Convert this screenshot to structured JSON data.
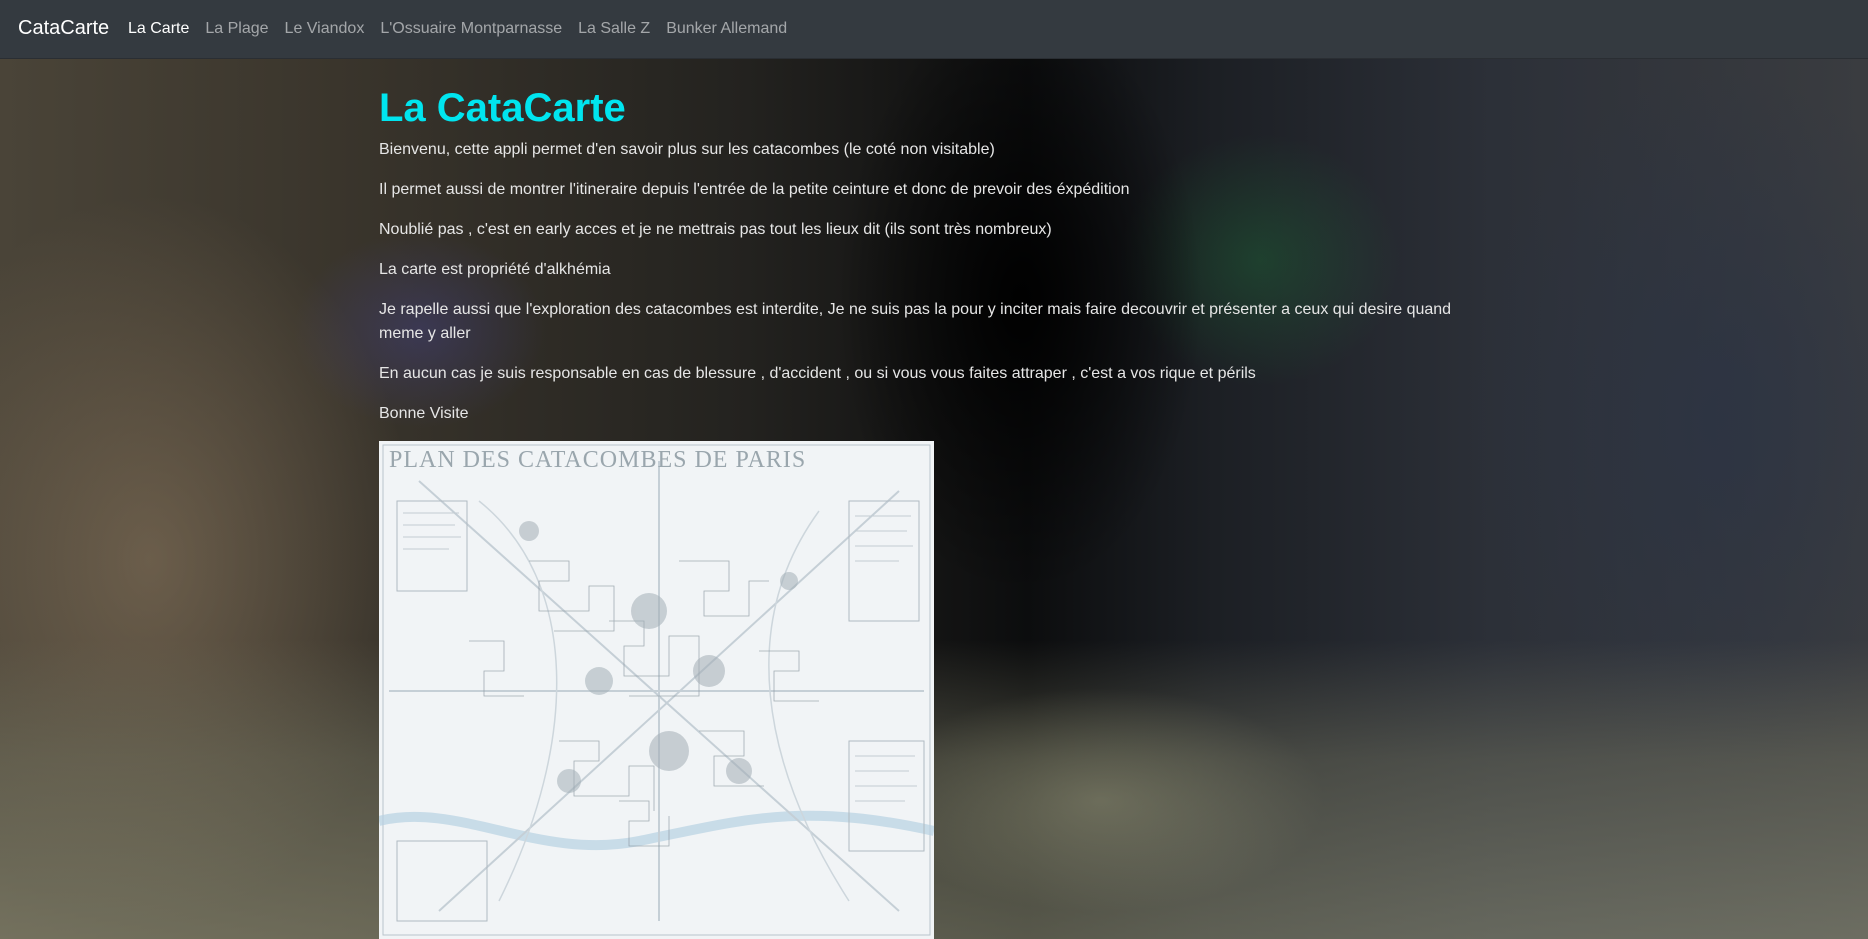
{
  "navbar": {
    "brand": "CataCarte",
    "links": [
      {
        "label": "La Carte"
      },
      {
        "label": "La Plage"
      },
      {
        "label": "Le Viandox"
      },
      {
        "label": "L'Ossuaire Montparnasse"
      },
      {
        "label": "La Salle Z"
      },
      {
        "label": "Bunker Allemand"
      }
    ]
  },
  "main": {
    "title": "La CataCarte",
    "paragraphs": [
      "Bienvenu, cette appli permet d'en savoir plus sur les catacombes (le coté non visitable)",
      "Il permet aussi de montrer l'itineraire depuis l'entrée de la petite ceinture et donc de prevoir des éxpédition",
      "Noublié pas , c'est en early acces et je ne mettrais pas tout les lieux dit (ils sont très nombreux)",
      "La carte est propriété d'alkhémia",
      "Je rapelle aussi que l'exploration des catacombes est interdite, Je ne suis pas la pour y inciter mais faire decouvrir et présenter a ceux qui desire quand meme y aller",
      "En aucun cas je suis responsable en cas de blessure , d'accident , ou si vous vous faites attraper , c'est a vos rique et périls",
      "Bonne Visite"
    ],
    "map": {
      "title": "PLAN DES CATACOMBES DE PARIS"
    }
  },
  "colors": {
    "navbar_bg": "#343a40",
    "title": "#00e5ef",
    "text": "#e6e6e6"
  }
}
